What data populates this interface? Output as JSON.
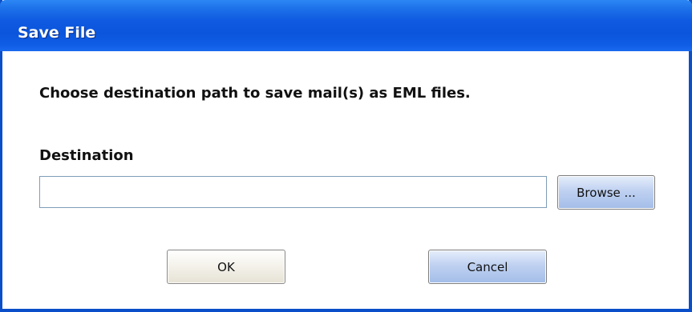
{
  "window": {
    "title": "Save File"
  },
  "body": {
    "prompt": "Choose destination path to save mail(s) as EML files.",
    "destination_label": "Destination",
    "destination_value": "",
    "browse_label": "Browse ..."
  },
  "footer": {
    "ok_label": "OK",
    "cancel_label": "Cancel"
  },
  "colors": {
    "titlebar": "#0b55dc",
    "border": "#0a4ec9",
    "title_text": "#ffffff"
  }
}
